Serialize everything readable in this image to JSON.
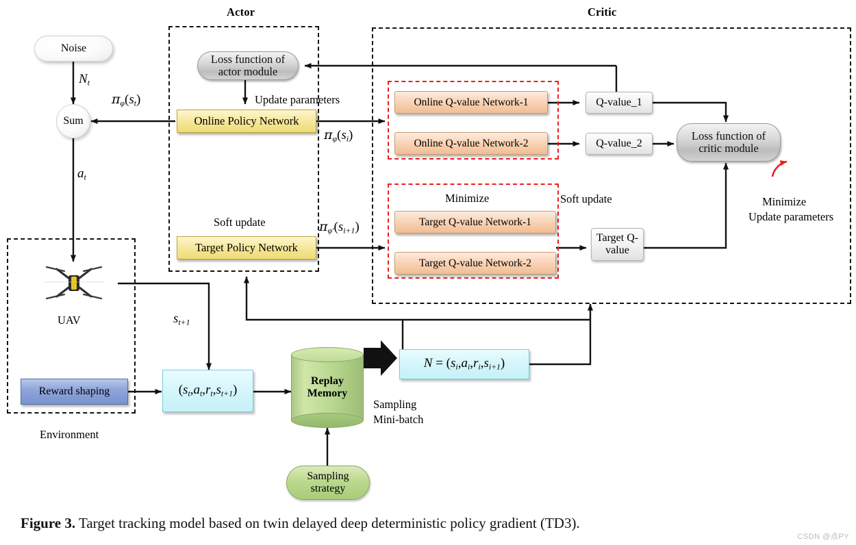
{
  "figure": {
    "caption_label": "Figure 3.",
    "caption_text": " Target tracking model based on twin delayed deep deterministic policy gradient (TD3).",
    "watermark": "CSDN @点PY"
  },
  "sections": {
    "actor_title": "Actor",
    "critic_title": "Critic",
    "environment_label": "Environment"
  },
  "actor": {
    "loss_function_line1": "Loss function of",
    "loss_function_line2": "actor module",
    "update_parameters": "Update parameters",
    "online_policy_network": "Online Policy Network",
    "soft_update": "Soft update",
    "target_policy_network": "Target Policy Network"
  },
  "critic": {
    "online_q1": "Online Q-value Network-1",
    "online_q2": "Online Q-value Network-2",
    "q_value_1": "Q-value_1",
    "q_value_2": "Q-value_2",
    "loss_function_line1": "Loss function of",
    "loss_function_line2": "critic module",
    "minimize_inner": "Minimize",
    "soft_update": "Soft update",
    "target_q1": "Target Q-value Network-1",
    "target_q2": "Target Q-value Network-2",
    "target_q_value_line1": "Target Q-",
    "target_q_value_line2": "value",
    "minimize_update_line1": "Minimize",
    "minimize_update_line2": "Update parameters"
  },
  "environment": {
    "noise": "Noise",
    "sum": "Sum",
    "uav": "UAV",
    "reward_shaping": "Reward shaping"
  },
  "memory": {
    "replay_memory_line1": "Replay",
    "replay_memory_line2": "Memory",
    "sampling_strategy_line1": "Sampling",
    "sampling_strategy_line2": "strategy",
    "sampling_minibatch_line1": "Sampling",
    "sampling_minibatch_line2": "Mini-batch"
  },
  "math_labels": {
    "noise_signal": "N_t",
    "action": "a_t",
    "policy_st": "π_φ(s_t)",
    "policy_si": "π_φ(s_i)",
    "target_policy_si1": "π_φ'(s_i+1)",
    "next_state": "s_t+1",
    "transition_tuple": "(s_t, a_t, r_t, s_t+1)",
    "minibatch_tuple": "N = (s_i, a_i, r_i, s_i+1)"
  },
  "colors": {
    "actor_box_border": "#111111",
    "critic_box_border": "#111111",
    "red_dashed": "#ee1c1c",
    "yellow_node": "#f3e28a",
    "orange_node": "#f6c9a6",
    "cyan_node": "#d6f6fb",
    "blue_node": "#8ea5da",
    "green_node": "#bcd98f",
    "grey_node": "#d7d7d7"
  }
}
